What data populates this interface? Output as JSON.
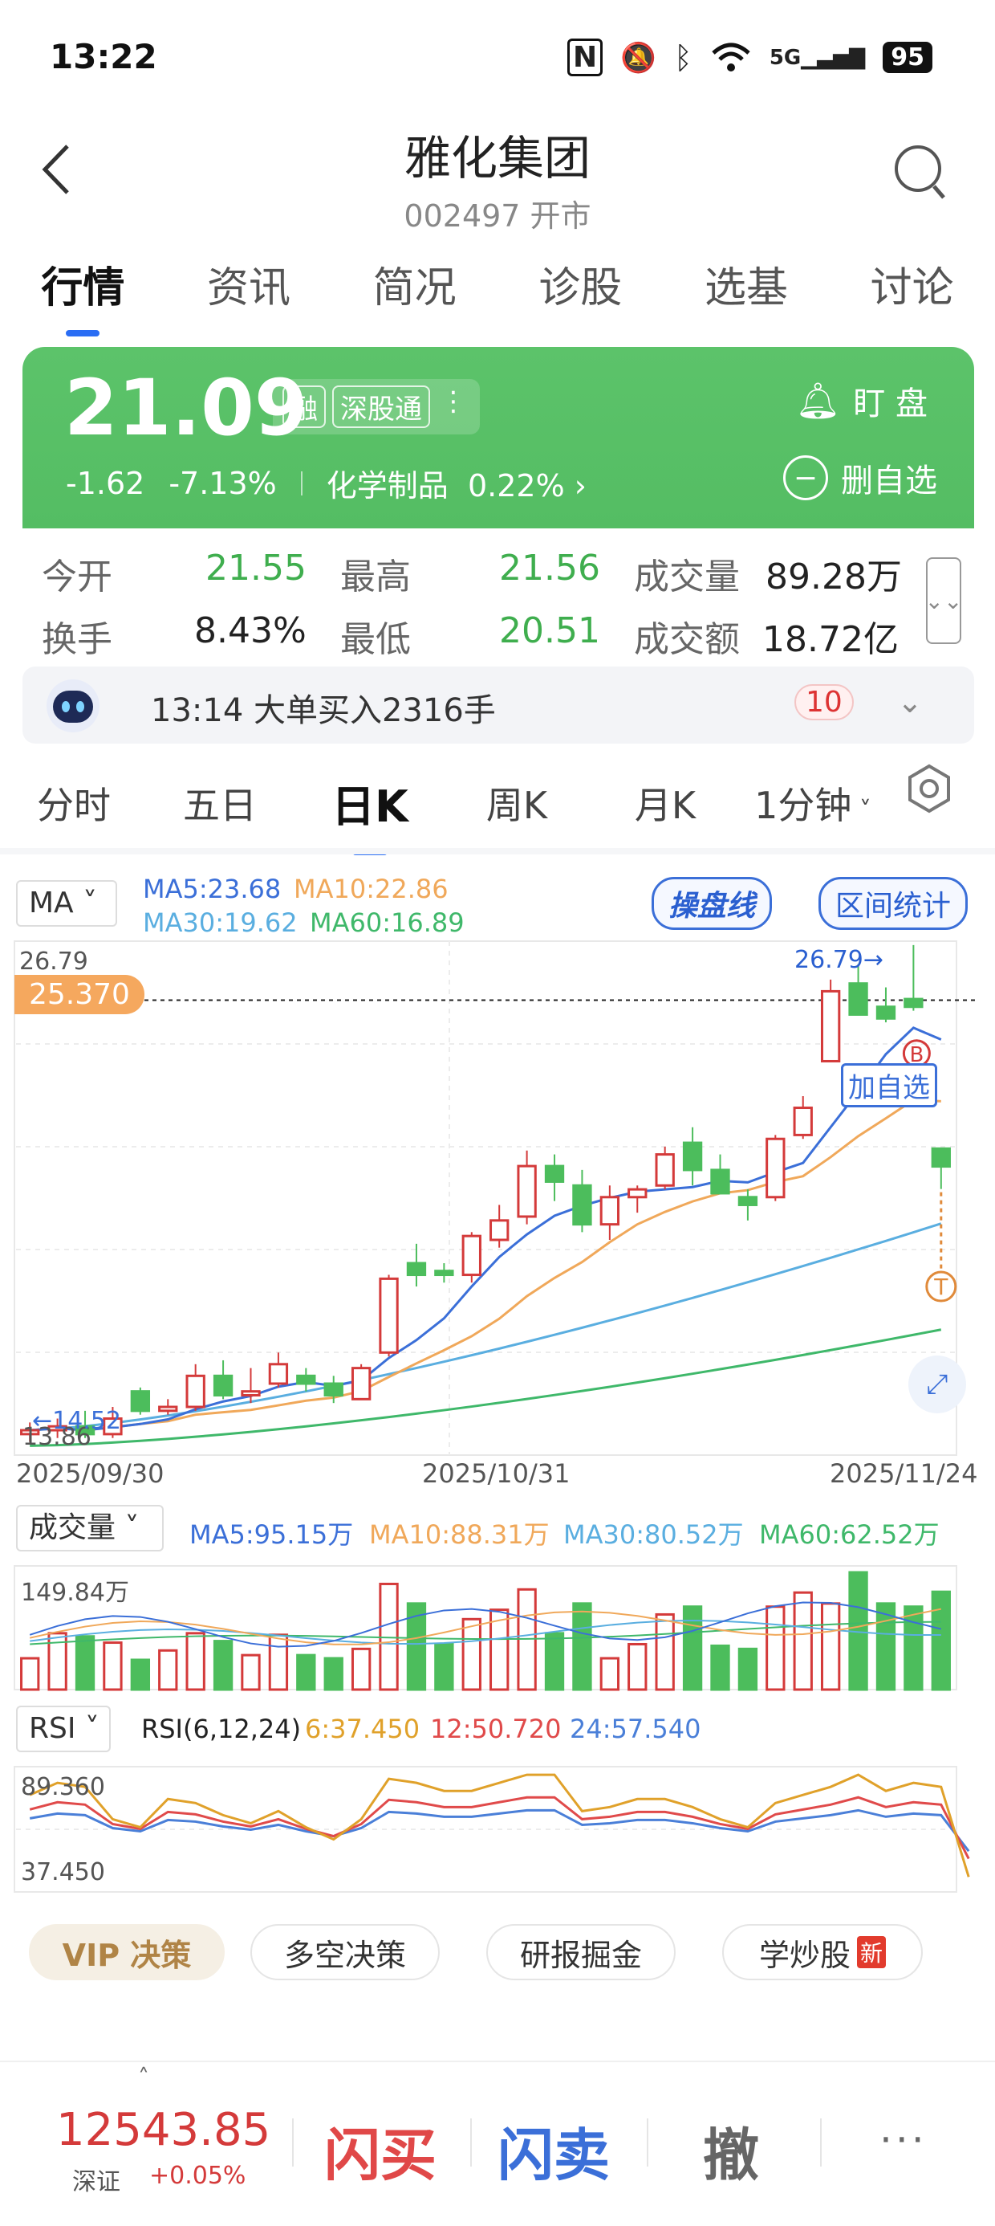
{
  "status": {
    "time": "13:22",
    "battery": "95",
    "network": "5G"
  },
  "header": {
    "title": "雅化集团",
    "subtitle": "002497 开市"
  },
  "tabs": [
    {
      "label": "行情",
      "active": true
    },
    {
      "label": "资讯"
    },
    {
      "label": "简况"
    },
    {
      "label": "诊股"
    },
    {
      "label": "选基"
    },
    {
      "label": "讨论"
    }
  ],
  "quote": {
    "price": "21.09",
    "badges": [
      "融",
      "深股通"
    ],
    "change": "-1.62",
    "change_pct": "-7.13%",
    "sector": "化学制品",
    "sector_pct": "0.22%",
    "watch_label": "盯 盘",
    "remove_label": "删自选"
  },
  "stats": {
    "open_label": "今开",
    "open": "21.55",
    "high_label": "最高",
    "high": "21.56",
    "volume_label": "成交量",
    "volume": "89.28万",
    "turnover_label": "换手",
    "turnover": "8.43%",
    "low_label": "最低",
    "low": "20.51",
    "amount_label": "成交额",
    "amount": "18.72亿"
  },
  "news": {
    "text": "13:14 大单买入2316手",
    "count": "10"
  },
  "periods": [
    {
      "label": "分时"
    },
    {
      "label": "五日"
    },
    {
      "label": "日K",
      "active": true
    },
    {
      "label": "周K"
    },
    {
      "label": "月K"
    },
    {
      "label": "1分钟"
    }
  ],
  "kline": {
    "indicator": "MA",
    "ma5": "MA5:23.68",
    "ma10": "MA10:22.86",
    "ma30": "MA30:19.62",
    "ma60": "MA60:16.89",
    "caopanxian": "操盘线",
    "interval_stats": "区间统计",
    "high_label": "26.79",
    "high_mark": "26.79→",
    "low_label": "13.86",
    "low_mark": "←14.52",
    "crosshair_price": "25.370",
    "add_watch": "加自选",
    "buy_mark": "B",
    "sell_mark": "T",
    "dates": [
      "2025/09/30",
      "2025/10/31",
      "2025/11/24"
    ]
  },
  "volume": {
    "indicator": "成交量",
    "ma5": "MA5:95.15万",
    "ma10": "MA10:88.31万",
    "ma30": "MA30:80.52万",
    "ma60": "MA60:62.52万",
    "max_label": "149.84万"
  },
  "rsi": {
    "indicator": "RSI",
    "title": "RSI(6,12,24)",
    "r6": "6:37.450",
    "r12": "12:50.720",
    "r24": "24:57.540",
    "top_label": "89.360",
    "bottom_label": "37.450"
  },
  "chips": {
    "vip": "VIP 决策",
    "long_short": "多空决策",
    "research": "研报掘金",
    "learn": "学炒股",
    "new": "新"
  },
  "bottom": {
    "index_value": "12543.85",
    "index_name": "深证",
    "index_change": "+0.05%",
    "buy": "闪买",
    "sell": "闪卖",
    "cancel": "撤",
    "more": "···"
  },
  "colors": {
    "up": "#d43a3a",
    "down": "#4cbd5c",
    "accent": "#2a6df4",
    "banner": "#55bf64"
  },
  "chart_data": {
    "type": "candlestick",
    "dates_shown": [
      "2025/09/30",
      "2025/10/31",
      "2025/11/24"
    ],
    "y_range": [
      13.86,
      26.79
    ],
    "candles": [
      [
        14.2,
        14.5,
        14.0,
        14.3
      ],
      [
        14.3,
        14.6,
        14.1,
        14.4
      ],
      [
        14.4,
        14.8,
        14.1,
        14.2
      ],
      [
        14.2,
        14.9,
        14.1,
        14.6
      ],
      [
        15.3,
        15.4,
        14.7,
        14.8
      ],
      [
        14.8,
        15.1,
        14.7,
        14.9
      ],
      [
        14.9,
        16.0,
        14.8,
        15.7
      ],
      [
        15.7,
        16.1,
        15.1,
        15.2
      ],
      [
        15.2,
        15.9,
        15.0,
        15.3
      ],
      [
        15.5,
        16.3,
        15.4,
        16.0
      ],
      [
        15.7,
        15.9,
        15.3,
        15.5
      ],
      [
        15.5,
        15.7,
        15.0,
        15.2
      ],
      [
        15.1,
        16.0,
        15.1,
        15.9
      ],
      [
        16.3,
        18.3,
        16.2,
        18.2
      ],
      [
        18.6,
        19.1,
        18.0,
        18.3
      ],
      [
        18.4,
        18.6,
        18.1,
        18.3
      ],
      [
        18.3,
        19.4,
        18.1,
        19.3
      ],
      [
        19.2,
        20.1,
        19.0,
        19.7
      ],
      [
        19.8,
        21.5,
        19.6,
        21.1
      ],
      [
        21.1,
        21.4,
        20.2,
        20.7
      ],
      [
        20.6,
        21.0,
        19.4,
        19.6
      ],
      [
        19.6,
        20.6,
        19.2,
        20.3
      ],
      [
        20.3,
        20.6,
        19.9,
        20.5
      ],
      [
        20.6,
        21.6,
        20.5,
        21.4
      ],
      [
        21.7,
        22.1,
        20.6,
        21.0
      ],
      [
        21.0,
        21.4,
        20.4,
        20.4
      ],
      [
        20.3,
        20.5,
        19.7,
        20.1
      ],
      [
        20.3,
        21.9,
        20.2,
        21.8
      ],
      [
        21.9,
        22.9,
        21.8,
        22.6
      ],
      [
        23.8,
        25.9,
        23.8,
        25.6
      ],
      [
        25.8,
        26.3,
        25.0,
        25.0
      ],
      [
        25.2,
        25.7,
        24.8,
        24.9
      ],
      [
        25.4,
        26.79,
        25.1,
        25.2
      ],
      [
        21.55,
        21.56,
        20.51,
        21.09
      ]
    ],
    "volume_max": "149.84万",
    "rsi_labels": [
      "89.360",
      "37.450"
    ]
  }
}
